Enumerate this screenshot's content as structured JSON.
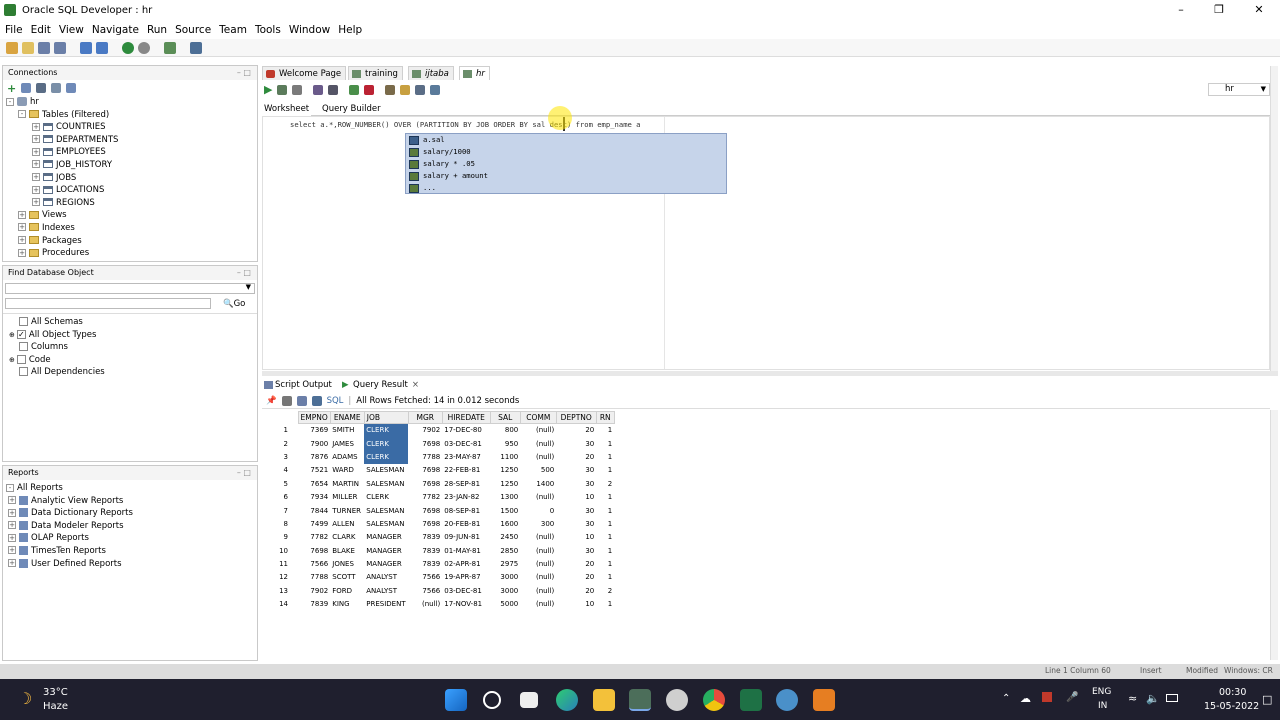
{
  "window": {
    "title": "Oracle SQL Developer : hr"
  },
  "menu": [
    "File",
    "Edit",
    "View",
    "Navigate",
    "Run",
    "Source",
    "Team",
    "Tools",
    "Window",
    "Help"
  ],
  "connections": {
    "header": "Connections",
    "root": "hr",
    "tables_label": "Tables (Filtered)",
    "tables": [
      "COUNTRIES",
      "DEPARTMENTS",
      "EMPLOYEES",
      "JOB_HISTORY",
      "JOBS",
      "LOCATIONS",
      "REGIONS"
    ],
    "other": [
      "Views",
      "Indexes",
      "Packages",
      "Procedures"
    ]
  },
  "find": {
    "header": "Find Database Object",
    "go_label": "Go",
    "options": [
      {
        "label": "All Schemas",
        "checked": false
      },
      {
        "label": "All Object Types",
        "checked": true
      },
      {
        "label": "Columns",
        "checked": false
      },
      {
        "label": "Code",
        "checked": false
      },
      {
        "label": "All Dependencies",
        "checked": false
      }
    ]
  },
  "reports": {
    "header": "Reports",
    "items": [
      "All Reports",
      "Analytic View Reports",
      "Data Dictionary Reports",
      "Data Modeler Reports",
      "OLAP Reports",
      "TimesTen Reports",
      "User Defined Reports"
    ]
  },
  "tabs": [
    "Welcome Page",
    "training",
    "ijtaba",
    "hr"
  ],
  "subtabs": [
    "Worksheet",
    "Query Builder"
  ],
  "connection_selector": "hr",
  "editor": {
    "sql": "select a.*,ROW_NUMBER() OVER (PARTITION BY JOB ORDER BY sal desc) from emp_name a",
    "autocomplete": [
      "a.sal",
      "salary/1000",
      "salary * .05",
      "salary + amount",
      "..."
    ]
  },
  "output_tabs": [
    "Script Output",
    "Query Result"
  ],
  "result": {
    "sql_label": "SQL",
    "status": "All Rows Fetched: 14 in 0.012 seconds",
    "columns": [
      "EMPNO",
      "ENAME",
      "JOB",
      "MGR",
      "HIREDATE",
      "SAL",
      "COMM",
      "DEPTNO",
      "RN"
    ],
    "rows": [
      [
        "7369",
        "SMITH",
        "CLERK",
        "7902",
        "17-DEC-80",
        "800",
        "(null)",
        "20",
        "1"
      ],
      [
        "7900",
        "JAMES",
        "CLERK",
        "7698",
        "03-DEC-81",
        "950",
        "(null)",
        "30",
        "1"
      ],
      [
        "7876",
        "ADAMS",
        "CLERK",
        "7788",
        "23-MAY-87",
        "1100",
        "(null)",
        "20",
        "1"
      ],
      [
        "7521",
        "WARD",
        "SALESMAN",
        "7698",
        "22-FEB-81",
        "1250",
        "500",
        "30",
        "1"
      ],
      [
        "7654",
        "MARTIN",
        "SALESMAN",
        "7698",
        "28-SEP-81",
        "1250",
        "1400",
        "30",
        "2"
      ],
      [
        "7934",
        "MILLER",
        "CLERK",
        "7782",
        "23-JAN-82",
        "1300",
        "(null)",
        "10",
        "1"
      ],
      [
        "7844",
        "TURNER",
        "SALESMAN",
        "7698",
        "08-SEP-81",
        "1500",
        "0",
        "30",
        "1"
      ],
      [
        "7499",
        "ALLEN",
        "SALESMAN",
        "7698",
        "20-FEB-81",
        "1600",
        "300",
        "30",
        "1"
      ],
      [
        "7782",
        "CLARK",
        "MANAGER",
        "7839",
        "09-JUN-81",
        "2450",
        "(null)",
        "10",
        "1"
      ],
      [
        "7698",
        "BLAKE",
        "MANAGER",
        "7839",
        "01-MAY-81",
        "2850",
        "(null)",
        "30",
        "1"
      ],
      [
        "7566",
        "JONES",
        "MANAGER",
        "7839",
        "02-APR-81",
        "2975",
        "(null)",
        "20",
        "1"
      ],
      [
        "7788",
        "SCOTT",
        "ANALYST",
        "7566",
        "19-APR-87",
        "3000",
        "(null)",
        "20",
        "1"
      ],
      [
        "7902",
        "FORD",
        "ANALYST",
        "7566",
        "03-DEC-81",
        "3000",
        "(null)",
        "20",
        "2"
      ],
      [
        "7839",
        "KING",
        "PRESIDENT",
        "(null)",
        "17-NOV-81",
        "5000",
        "(null)",
        "10",
        "1"
      ]
    ]
  },
  "status_bar": {
    "position": "Line 1 Column 60",
    "mode": "Insert",
    "modified": "Modified",
    "eol": "Windows: CR"
  },
  "taskbar": {
    "weather_temp": "33°C",
    "weather_desc": "Haze",
    "lang": "ENG",
    "region": "IN",
    "time": "00:30",
    "date": "15-05-2022"
  }
}
